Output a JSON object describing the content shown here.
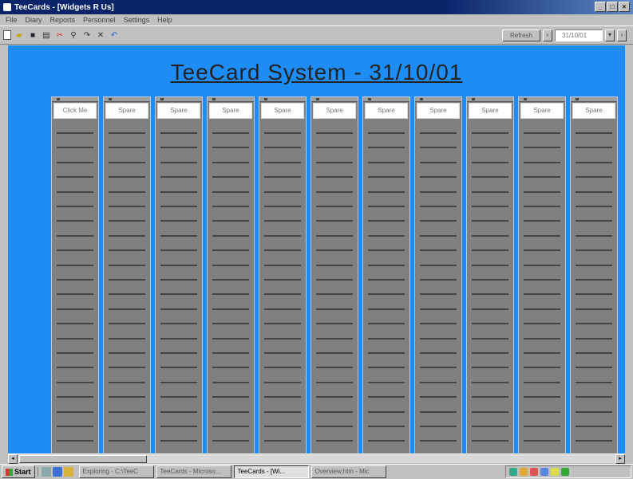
{
  "window": {
    "title": "TeeCards - [Widgets R Us]"
  },
  "menu": [
    "File",
    "Diary",
    "Reports",
    "Personnel",
    "Settings",
    "Help"
  ],
  "toolbar": {
    "refresh_label": "Refresh",
    "date_value": "31/10/01"
  },
  "main": {
    "title": "TeeCard System - 31/10/01",
    "columns": [
      {
        "label": "Click Me"
      },
      {
        "label": "Spare"
      },
      {
        "label": "Spare"
      },
      {
        "label": "Spare"
      },
      {
        "label": "Spare"
      },
      {
        "label": "Spare"
      },
      {
        "label": "Spare"
      },
      {
        "label": "Spare"
      },
      {
        "label": "Spare"
      },
      {
        "label": "Spare"
      },
      {
        "label": "Spare"
      }
    ]
  },
  "taskbar": {
    "start_label": "Start",
    "tasks": [
      {
        "label": "Exploring - C:\\TeeC"
      },
      {
        "label": "TeeCards - Microso..."
      },
      {
        "label": "TeeCards - [Wi..."
      },
      {
        "label": "Overview.htm - Mic"
      }
    ]
  }
}
